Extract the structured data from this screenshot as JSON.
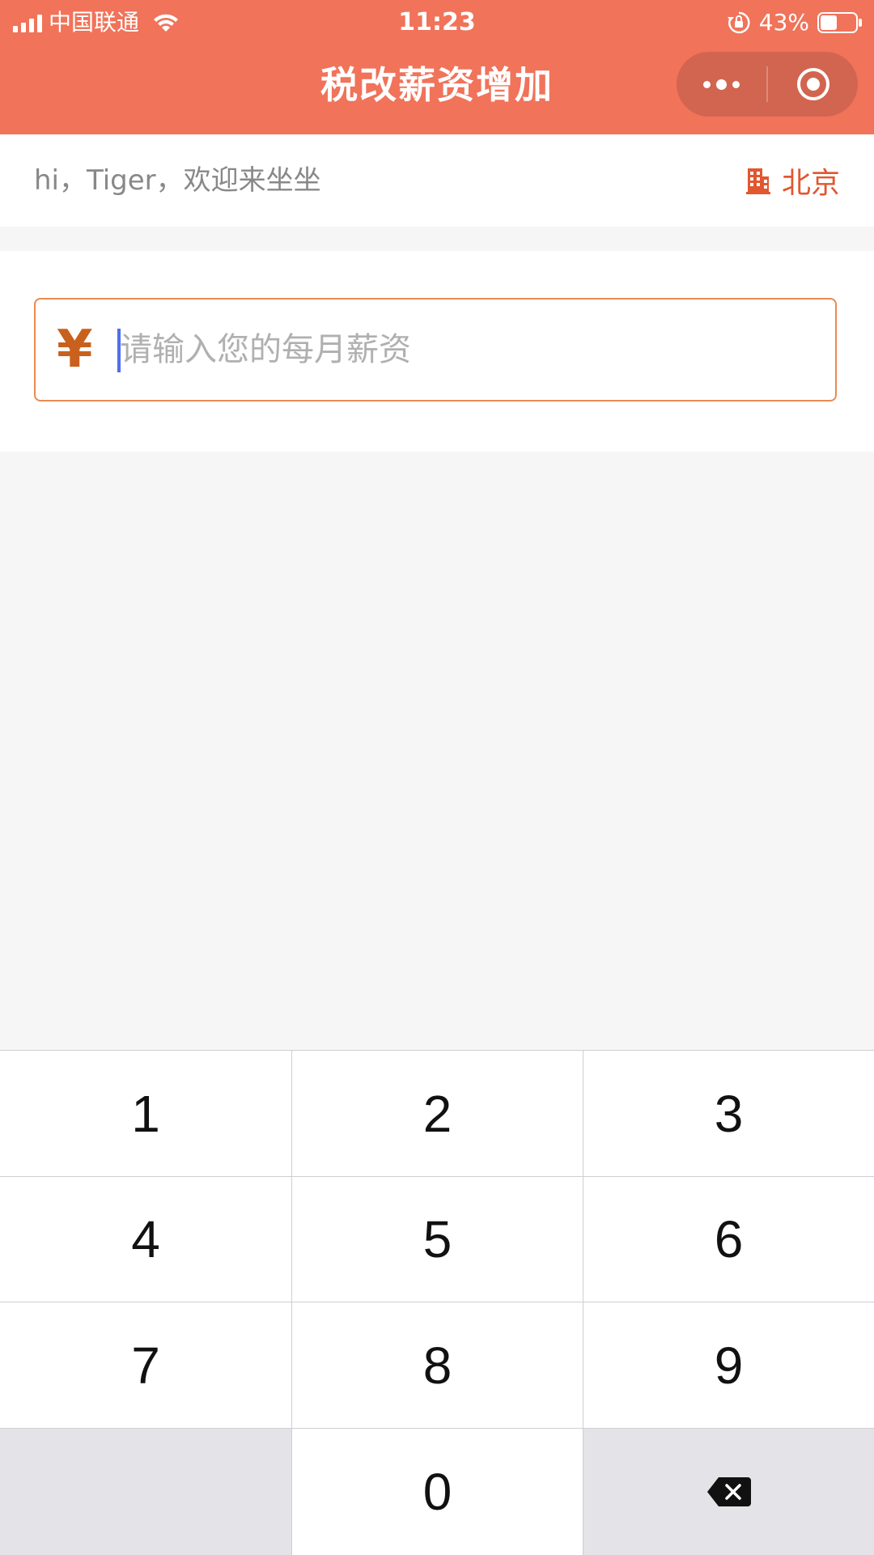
{
  "status_bar": {
    "carrier": "中国联通",
    "time": "11:23",
    "battery": "43%"
  },
  "nav": {
    "title": "税改薪资增加",
    "more_icon": "more-dots-icon",
    "close_icon": "target-close-icon"
  },
  "greeting": {
    "text": "hi，Tiger，欢迎来坐坐",
    "city": "北京",
    "city_icon": "building-icon"
  },
  "salary_input": {
    "currency_symbol": "¥",
    "placeholder": "请输入您的每月薪资",
    "value": ""
  },
  "keypad": {
    "keys": [
      "1",
      "2",
      "3",
      "4",
      "5",
      "6",
      "7",
      "8",
      "9",
      "",
      "0",
      "delete"
    ],
    "delete_icon": "backspace-icon"
  },
  "colors": {
    "header": "#f0735a",
    "accent": "#e1572f",
    "input_border": "#ea8a52",
    "currency": "#c9611e"
  }
}
